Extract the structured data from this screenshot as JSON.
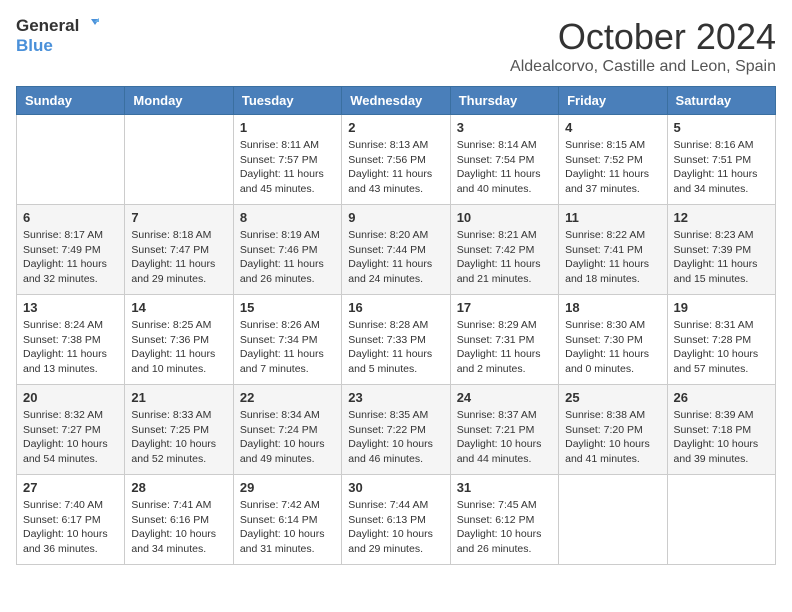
{
  "header": {
    "logo_general": "General",
    "logo_blue": "Blue",
    "month": "October 2024",
    "location": "Aldealcorvo, Castille and Leon, Spain"
  },
  "calendar": {
    "weekdays": [
      "Sunday",
      "Monday",
      "Tuesday",
      "Wednesday",
      "Thursday",
      "Friday",
      "Saturday"
    ],
    "weeks": [
      [
        {
          "day": "",
          "info": ""
        },
        {
          "day": "",
          "info": ""
        },
        {
          "day": "1",
          "info": "Sunrise: 8:11 AM\nSunset: 7:57 PM\nDaylight: 11 hours and 45 minutes."
        },
        {
          "day": "2",
          "info": "Sunrise: 8:13 AM\nSunset: 7:56 PM\nDaylight: 11 hours and 43 minutes."
        },
        {
          "day": "3",
          "info": "Sunrise: 8:14 AM\nSunset: 7:54 PM\nDaylight: 11 hours and 40 minutes."
        },
        {
          "day": "4",
          "info": "Sunrise: 8:15 AM\nSunset: 7:52 PM\nDaylight: 11 hours and 37 minutes."
        },
        {
          "day": "5",
          "info": "Sunrise: 8:16 AM\nSunset: 7:51 PM\nDaylight: 11 hours and 34 minutes."
        }
      ],
      [
        {
          "day": "6",
          "info": "Sunrise: 8:17 AM\nSunset: 7:49 PM\nDaylight: 11 hours and 32 minutes."
        },
        {
          "day": "7",
          "info": "Sunrise: 8:18 AM\nSunset: 7:47 PM\nDaylight: 11 hours and 29 minutes."
        },
        {
          "day": "8",
          "info": "Sunrise: 8:19 AM\nSunset: 7:46 PM\nDaylight: 11 hours and 26 minutes."
        },
        {
          "day": "9",
          "info": "Sunrise: 8:20 AM\nSunset: 7:44 PM\nDaylight: 11 hours and 24 minutes."
        },
        {
          "day": "10",
          "info": "Sunrise: 8:21 AM\nSunset: 7:42 PM\nDaylight: 11 hours and 21 minutes."
        },
        {
          "day": "11",
          "info": "Sunrise: 8:22 AM\nSunset: 7:41 PM\nDaylight: 11 hours and 18 minutes."
        },
        {
          "day": "12",
          "info": "Sunrise: 8:23 AM\nSunset: 7:39 PM\nDaylight: 11 hours and 15 minutes."
        }
      ],
      [
        {
          "day": "13",
          "info": "Sunrise: 8:24 AM\nSunset: 7:38 PM\nDaylight: 11 hours and 13 minutes."
        },
        {
          "day": "14",
          "info": "Sunrise: 8:25 AM\nSunset: 7:36 PM\nDaylight: 11 hours and 10 minutes."
        },
        {
          "day": "15",
          "info": "Sunrise: 8:26 AM\nSunset: 7:34 PM\nDaylight: 11 hours and 7 minutes."
        },
        {
          "day": "16",
          "info": "Sunrise: 8:28 AM\nSunset: 7:33 PM\nDaylight: 11 hours and 5 minutes."
        },
        {
          "day": "17",
          "info": "Sunrise: 8:29 AM\nSunset: 7:31 PM\nDaylight: 11 hours and 2 minutes."
        },
        {
          "day": "18",
          "info": "Sunrise: 8:30 AM\nSunset: 7:30 PM\nDaylight: 11 hours and 0 minutes."
        },
        {
          "day": "19",
          "info": "Sunrise: 8:31 AM\nSunset: 7:28 PM\nDaylight: 10 hours and 57 minutes."
        }
      ],
      [
        {
          "day": "20",
          "info": "Sunrise: 8:32 AM\nSunset: 7:27 PM\nDaylight: 10 hours and 54 minutes."
        },
        {
          "day": "21",
          "info": "Sunrise: 8:33 AM\nSunset: 7:25 PM\nDaylight: 10 hours and 52 minutes."
        },
        {
          "day": "22",
          "info": "Sunrise: 8:34 AM\nSunset: 7:24 PM\nDaylight: 10 hours and 49 minutes."
        },
        {
          "day": "23",
          "info": "Sunrise: 8:35 AM\nSunset: 7:22 PM\nDaylight: 10 hours and 46 minutes."
        },
        {
          "day": "24",
          "info": "Sunrise: 8:37 AM\nSunset: 7:21 PM\nDaylight: 10 hours and 44 minutes."
        },
        {
          "day": "25",
          "info": "Sunrise: 8:38 AM\nSunset: 7:20 PM\nDaylight: 10 hours and 41 minutes."
        },
        {
          "day": "26",
          "info": "Sunrise: 8:39 AM\nSunset: 7:18 PM\nDaylight: 10 hours and 39 minutes."
        }
      ],
      [
        {
          "day": "27",
          "info": "Sunrise: 7:40 AM\nSunset: 6:17 PM\nDaylight: 10 hours and 36 minutes."
        },
        {
          "day": "28",
          "info": "Sunrise: 7:41 AM\nSunset: 6:16 PM\nDaylight: 10 hours and 34 minutes."
        },
        {
          "day": "29",
          "info": "Sunrise: 7:42 AM\nSunset: 6:14 PM\nDaylight: 10 hours and 31 minutes."
        },
        {
          "day": "30",
          "info": "Sunrise: 7:44 AM\nSunset: 6:13 PM\nDaylight: 10 hours and 29 minutes."
        },
        {
          "day": "31",
          "info": "Sunrise: 7:45 AM\nSunset: 6:12 PM\nDaylight: 10 hours and 26 minutes."
        },
        {
          "day": "",
          "info": ""
        },
        {
          "day": "",
          "info": ""
        }
      ]
    ]
  }
}
